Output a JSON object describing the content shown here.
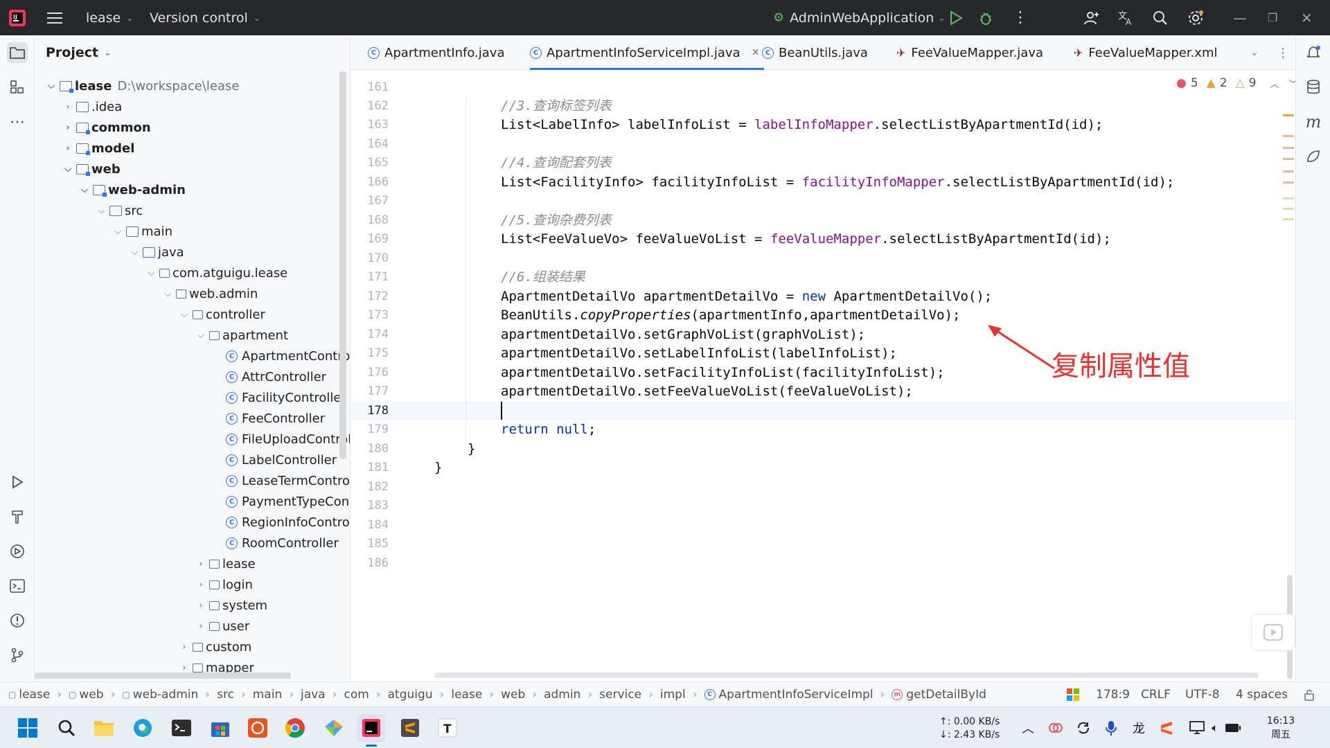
{
  "topbar": {
    "project_name": "lease",
    "vcs_label": "Version control",
    "run_config": "AdminWebApplication"
  },
  "project_panel": {
    "title": "Project",
    "tree": [
      {
        "label": "lease",
        "path": "D:\\workspace\\lease"
      },
      {
        "label": ".idea"
      },
      {
        "label": "common"
      },
      {
        "label": "model"
      },
      {
        "label": "web"
      },
      {
        "label": "web-admin"
      },
      {
        "label": "src"
      },
      {
        "label": "main"
      },
      {
        "label": "java"
      },
      {
        "label": "com.atguigu.lease"
      },
      {
        "label": "web.admin"
      },
      {
        "label": "controller"
      },
      {
        "label": "apartment"
      },
      {
        "label": "ApartmentControll"
      },
      {
        "label": "AttrController"
      },
      {
        "label": "FacilityController"
      },
      {
        "label": "FeeController"
      },
      {
        "label": "FileUploadControll"
      },
      {
        "label": "LabelController"
      },
      {
        "label": "LeaseTermControl"
      },
      {
        "label": "PaymentTypeConi"
      },
      {
        "label": "RegionInfoControll"
      },
      {
        "label": "RoomController"
      },
      {
        "label": "lease"
      },
      {
        "label": "login"
      },
      {
        "label": "system"
      },
      {
        "label": "user"
      },
      {
        "label": "custom"
      },
      {
        "label": "mapper"
      }
    ]
  },
  "tabs": [
    {
      "label": "ApartmentInfo.java"
    },
    {
      "label": "ApartmentInfoServiceImpl.java"
    },
    {
      "label": "BeanUtils.java"
    },
    {
      "label": "FeeValueMapper.java"
    },
    {
      "label": "FeeValueMapper.xml"
    }
  ],
  "inspections": {
    "errors": "5",
    "warnings": "2",
    "weak_warnings": "9"
  },
  "editor": {
    "line_numbers": [
      "161",
      "162",
      "163",
      "164",
      "165",
      "166",
      "167",
      "168",
      "169",
      "170",
      "171",
      "172",
      "173",
      "174",
      "175",
      "176",
      "177",
      "178",
      "179",
      "180",
      "181",
      "182",
      "183",
      "184",
      "185",
      "186"
    ],
    "code": {
      "c162": "//3.查询标签列表",
      "c163_type": "List<LabelInfo> labelInfoList = ",
      "c163_field": "labelInfoMapper",
      "c163_rest": ".selectListByApartmentId(id);",
      "c165": "//4.查询配套列表",
      "c166_type": "List<FacilityInfo> facilityInfoList = ",
      "c166_field": "facilityInfoMapper",
      "c166_rest": ".selectListByApartmentId(id);",
      "c168": "//5.查询杂费列表",
      "c169_type": "List<FeeValueVo> feeValueVoList = ",
      "c169_field": "feeValueMapper",
      "c169_rest": ".selectListByApartmentId(id);",
      "c171": "//6.组装结果",
      "c172_a": "ApartmentDetailVo apartmentDetailVo = ",
      "c172_kw": "new",
      "c172_b": " ApartmentDetailVo();",
      "c173_a": "BeanUtils.",
      "c173_m": "copyProperties",
      "c173_b": "(apartmentInfo,apartmentDetailVo);",
      "c174": "apartmentDetailVo.setGraphVoList(graphVoList);",
      "c175": "apartmentDetailVo.setLabelInfoList(labelInfoList);",
      "c176": "apartmentDetailVo.setFacilityInfoList(facilityInfoList);",
      "c177": "apartmentDetailVo.setFeeValueVoList(feeValueVoList);",
      "c179_kw": "return",
      "c179_kw2": "null",
      "c179_end": ";",
      "c180": "}",
      "c181": "}"
    },
    "annotation": "复制属性值"
  },
  "statusbar": {
    "breadcrumb": [
      "lease",
      "web",
      "web-admin",
      "src",
      "main",
      "java",
      "com",
      "atguigu",
      "lease",
      "web",
      "admin",
      "service",
      "impl",
      "ApartmentInfoServiceImpl",
      "getDetailById"
    ],
    "position": "178:9",
    "line_sep": "CRLF",
    "encoding": "UTF-8",
    "indent": "4 spaces"
  },
  "taskbar": {
    "net_up": "↑: 0.00 KB/s",
    "net_down": "↓: 2.43 KB/s",
    "time": "16:13",
    "day": "周五"
  },
  "colors": {
    "accent": "#3574f0",
    "error": "#e55765",
    "warning": "#e9a440",
    "annotation": "#e8312f"
  }
}
